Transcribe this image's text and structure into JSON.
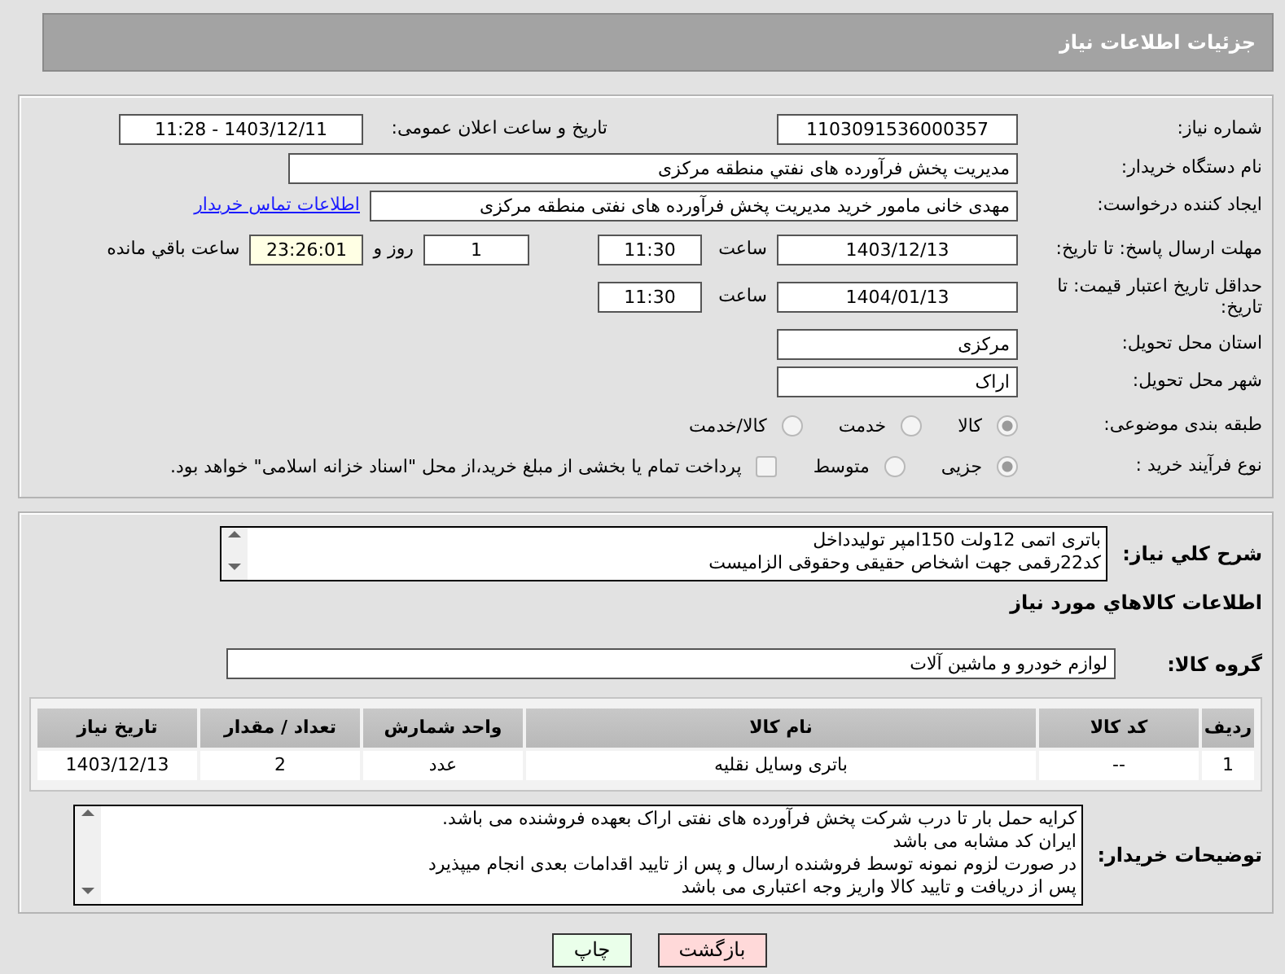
{
  "header": {
    "title": "جزئیات اطلاعات نیاز"
  },
  "need_number": {
    "label": "شماره نیاز:",
    "value": "1103091536000357"
  },
  "announce": {
    "label": "تاریخ و ساعت اعلان عمومی:",
    "value": "1403/12/11 - 11:28"
  },
  "buyer_org": {
    "label": "نام دستگاه خریدار:",
    "value": "مدیریت پخش فرآورده های نفتي منطقه مرکزی"
  },
  "requester": {
    "label": "ایجاد کننده درخواست:",
    "value": "مهدی خانی مامور خرید مدیریت پخش فرآورده های نفتی منطقه مرکزی",
    "link": "اطلاعات تماس خریدار"
  },
  "reply_deadline": {
    "label": "مهلت ارسال پاسخ: تا تاریخ:",
    "date": "1403/12/13",
    "time_label": "ساعت",
    "time": "11:30",
    "days": "1",
    "days_label": "روز و",
    "remaining": "23:26:01",
    "remaining_label": "ساعت باقي مانده"
  },
  "price_validity": {
    "label": "حداقل تاریخ اعتبار قیمت: تا تاریخ:",
    "date": "1404/01/13",
    "time_label": "ساعت",
    "time": "11:30"
  },
  "province": {
    "label": "استان محل تحویل:",
    "value": "مرکزی"
  },
  "city": {
    "label": "شهر محل تحویل:",
    "value": "اراک"
  },
  "category": {
    "label": "طبقه بندی موضوعی:",
    "options": [
      {
        "label": "کالا",
        "selected": true
      },
      {
        "label": "خدمت",
        "selected": false
      },
      {
        "label": "کالا/خدمت",
        "selected": false
      }
    ]
  },
  "process": {
    "label": "نوع فرآیند خرید :",
    "options": [
      {
        "label": "جزیی",
        "selected": true
      },
      {
        "label": "متوسط",
        "selected": false
      }
    ],
    "payment": {
      "label": "پرداخت تمام یا بخشی از مبلغ خرید،از محل \"اسناد خزانه اسلامی\" خواهد بود.",
      "checked": false
    }
  },
  "description": {
    "label": "شرح کلي نياز:",
    "lines": [
      "باتری اتمی 12ولت 150امپر تولیدداخل",
      "کد22رقمی  جهت اشخاص حقیقی وحقوقی الزامیست"
    ]
  },
  "goods_heading": "اطلاعات کالاهاي مورد نياز",
  "goods_group": {
    "label": "گروه کالا:",
    "value": "لوازم خودرو و ماشین آلات"
  },
  "table": {
    "columns": [
      "ردیف",
      "کد کالا",
      "نام کالا",
      "واحد شمارش",
      "تعداد / مقدار",
      "تاریخ نیاز"
    ],
    "rows": [
      [
        "1",
        "--",
        "باتری وسایل نقلیه",
        "عدد",
        "2",
        "1403/12/13"
      ]
    ]
  },
  "buyer_notes": {
    "label": "توضیحات خریدار:",
    "lines": [
      "کرایه حمل بار تا درب شرکت  پخش فرآورده های نفتی اراک بعهده فروشنده می باشد.",
      "ایران کد مشابه می باشد",
      "در صورت لزوم نمونه توسط فروشنده ارسال و پس از تایید اقدامات بعدی انجام میپذیرد",
      "پس از دریافت و تایید کالا واریز وجه اعتباری می باشد"
    ]
  },
  "buttons": [
    {
      "label": "بازگشت",
      "kind": "back"
    },
    {
      "label": "چاپ",
      "kind": "print"
    }
  ]
}
